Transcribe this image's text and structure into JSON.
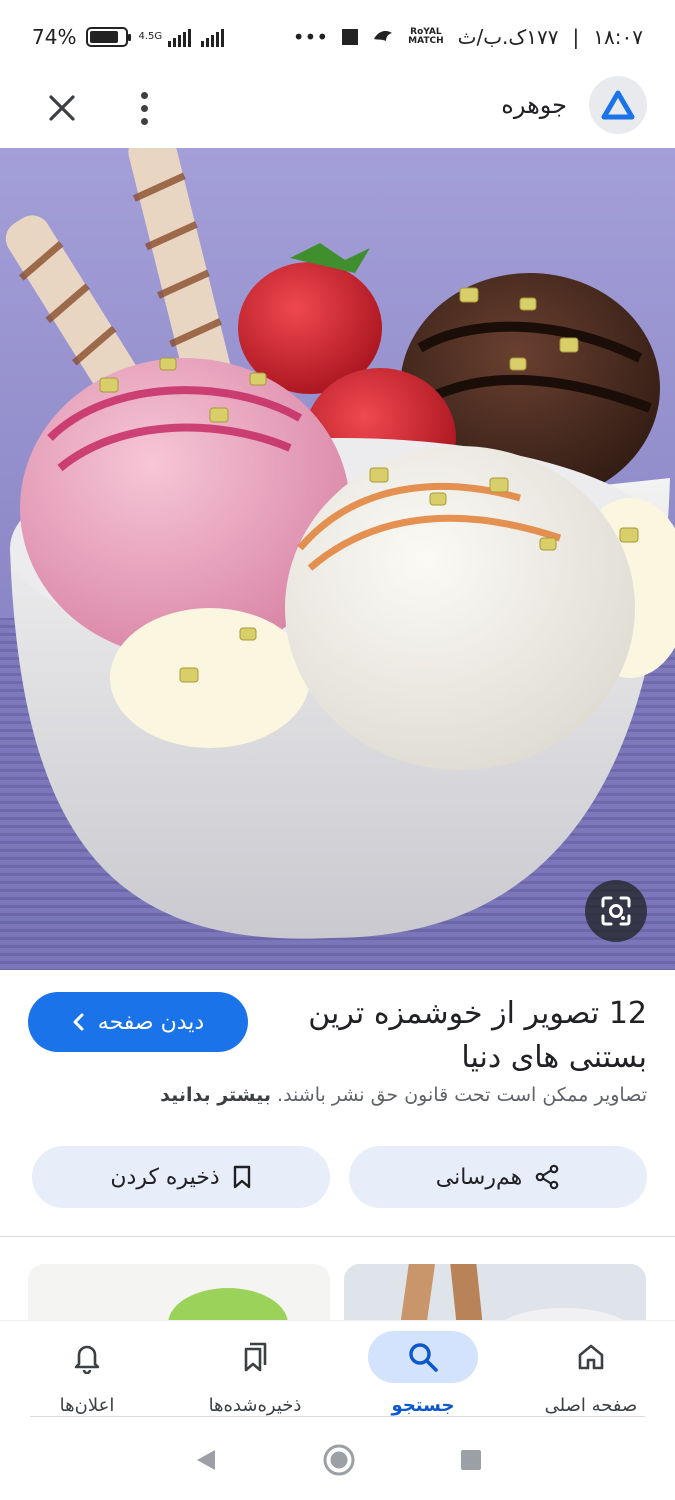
{
  "status_bar": {
    "battery_text": "74%",
    "battery_level": 0.74,
    "network_label": "4.5G",
    "time": "۱۸:۰۷",
    "extra_status": "۱۷۷ک.ب/ث",
    "more_dots": "•••"
  },
  "app_bar": {
    "site_name": "جوهره",
    "close_icon": "close-icon",
    "more_icon": "more-vert-icon"
  },
  "hero_image": {
    "subject": "ice-cream-bowl"
  },
  "result": {
    "title": "12 تصویر از خوشمزه ترین بستنی های دنیا",
    "visit_label": "دیدن صفحه",
    "copyright_text": "تصاویر ممکن است تحت قانون حق نشر باشند.",
    "learn_more": "بیشتر بدانید",
    "share_label": "هم‌رسانی",
    "save_label": "ذخیره کردن"
  },
  "bottom_nav": {
    "items": [
      {
        "label": "صفحه اصلی",
        "icon": "home-icon",
        "active": false
      },
      {
        "label": "جستجو",
        "icon": "search-icon",
        "active": true
      },
      {
        "label": "ذخیره‌شده‌ها",
        "icon": "bookmarks-icon",
        "active": false
      },
      {
        "label": "اعلان‌ها",
        "icon": "bell-icon",
        "active": false
      }
    ]
  },
  "colors": {
    "accent": "#1a73e8",
    "active_nav_bg": "#d3e3fd",
    "pill_bg": "#e8eef9"
  }
}
